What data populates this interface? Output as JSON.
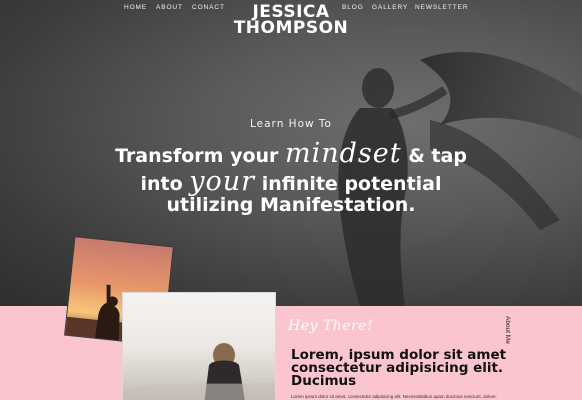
{
  "nav": {
    "items": [
      {
        "label": "HOME"
      },
      {
        "label": "ABOUT"
      },
      {
        "label": "CONACT"
      },
      {
        "label": "BLOG"
      },
      {
        "label": "GALLERY"
      },
      {
        "label": "NEWSLETTER"
      }
    ],
    "brand_line1": "JESSICA",
    "brand_line2": "THOMPSON"
  },
  "hero": {
    "kicker": "Learn How To",
    "line1_before": "Transform your ",
    "line1_script": "mindset",
    "line1_after": " & tap",
    "line2_before": "into ",
    "line2_script": "your",
    "line2_after": " infinite potential",
    "line3": "utilizing Manifestation."
  },
  "about": {
    "greeting": "Hey There!",
    "side_label": "About Me",
    "heading": "Lorem, ipsum dolor sit amet consectetur adipisicing elit. Ducimus",
    "body": "Lorem ipsum dolor sit amet, consectetur adipisicing elit. Necessitatibus quam ducimus nesciunt, dolore."
  },
  "colors": {
    "pink_band": "#fbc5cf",
    "hero_bg": "#5a5a5a",
    "text_light": "#ffffff"
  }
}
